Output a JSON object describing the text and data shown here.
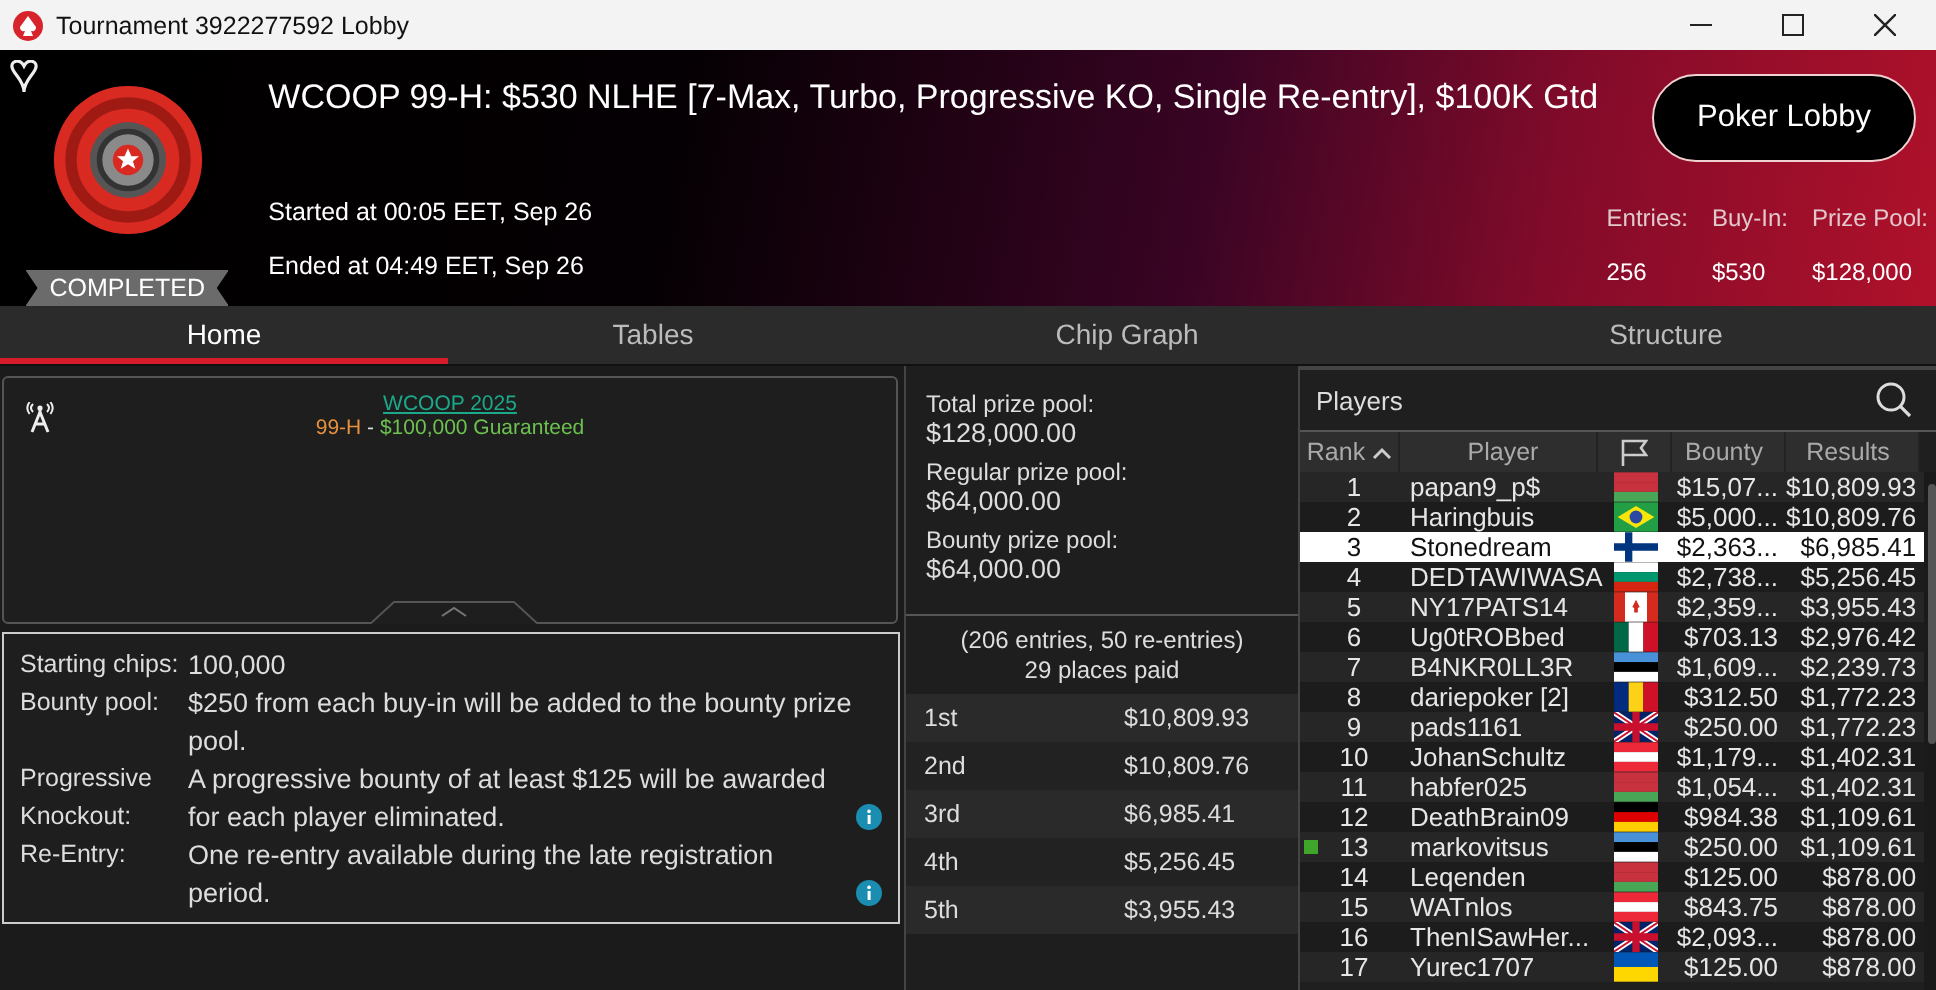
{
  "window": {
    "title": "Tournament 3922277592 Lobby"
  },
  "header": {
    "favorite": false,
    "title": "WCOOP 99-H: $530 NLHE [7-Max, Turbo, Progressive KO, Single Re-entry], $100K Gtd",
    "status": "COMPLETED",
    "started": "Started at 00:05 EET, Sep 26",
    "ended": "Ended at 04:49 EET, Sep 26",
    "button": "Poker Lobby",
    "stats": [
      {
        "label": "Entries:",
        "value": "256"
      },
      {
        "label": "Buy-In:",
        "value": "$530"
      },
      {
        "label": "Prize Pool:",
        "value": "$128,000"
      }
    ]
  },
  "tabs": [
    {
      "label": "Home",
      "selected": true
    },
    {
      "label": "Tables",
      "selected": false
    },
    {
      "label": "Chip Graph",
      "selected": false
    },
    {
      "label": "Structure",
      "selected": false
    }
  ],
  "banner": {
    "link": "WCOOP 2025",
    "event": "99-H",
    "separator": " - ",
    "guarantee": "$100,000 Guaranteed"
  },
  "details": [
    {
      "label": "Starting chips:",
      "value": "100,000",
      "info": false
    },
    {
      "label": "Bounty pool:",
      "value": "$250 from each buy-in will be added to the bounty prize pool.",
      "info": false
    },
    {
      "label": "Progressive Knockout:",
      "value": "A progressive bounty of at least $125 will be awarded for each player eliminated.",
      "info": true
    },
    {
      "label": "Re-Entry:",
      "value": "One re-entry available during the late registration period.",
      "info": true
    }
  ],
  "pools": [
    {
      "label": "Total prize pool:",
      "value": "$128,000.00"
    },
    {
      "label": "Regular prize pool:",
      "value": "$64,000.00"
    },
    {
      "label": "Bounty prize pool:",
      "value": "$64,000.00"
    }
  ],
  "entries_note": "(206 entries, 50 re-entries)",
  "places_paid": "29 places paid",
  "payouts": [
    {
      "place": "1st",
      "amount": "$10,809.93"
    },
    {
      "place": "2nd",
      "amount": "$10,809.76"
    },
    {
      "place": "3rd",
      "amount": "$6,985.41"
    },
    {
      "place": "4th",
      "amount": "$5,256.45"
    },
    {
      "place": "5th",
      "amount": "$3,955.43"
    }
  ],
  "players": {
    "title": "Players",
    "columns": [
      "Rank",
      "Player",
      "Bounty",
      "Results"
    ],
    "rows": [
      {
        "rank": "1",
        "player": "papan9_p$",
        "bounty": "$15,07...",
        "result": "$10,809.93",
        "selected": false,
        "marked": false,
        "flag": {
          "kind": "stripes",
          "parts": [
            {
              "color": "#c8313e"
            },
            {
              "color": "#c8313e"
            },
            {
              "color": "#4aa657"
            }
          ]
        }
      },
      {
        "rank": "2",
        "player": "Haringbuis",
        "bounty": "$5,000...",
        "result": "$10,809.76",
        "selected": false,
        "marked": false,
        "flag": {
          "kind": "diamond",
          "parts": [
            {
              "color": "#229e45"
            },
            {
              "color": "#f8e509"
            },
            {
              "color": "#2b49a3"
            }
          ]
        }
      },
      {
        "rank": "3",
        "player": "Stonedream",
        "bounty": "$2,363...",
        "result": "$6,985.41",
        "selected": true,
        "marked": false,
        "flag": {
          "kind": "cross",
          "parts": [
            {
              "color": "#ffffff"
            },
            {
              "color": "#003580"
            }
          ]
        }
      },
      {
        "rank": "4",
        "player": "DEDTAWIWASA",
        "bounty": "$2,738...",
        "result": "$5,256.45",
        "selected": false,
        "marked": false,
        "flag": {
          "kind": "stripes",
          "parts": [
            {
              "color": "#ffffff"
            },
            {
              "color": "#00966e"
            },
            {
              "color": "#d62612"
            }
          ]
        }
      },
      {
        "rank": "5",
        "player": "NY17PATS14",
        "bounty": "$2,359...",
        "result": "$3,955.43",
        "selected": false,
        "marked": false,
        "flag": {
          "kind": "maple",
          "parts": [
            {
              "color": "#d52b1e"
            },
            {
              "color": "#ffffff"
            }
          ]
        }
      },
      {
        "rank": "6",
        "player": "Ug0tROBbed",
        "bounty": "$703.13",
        "result": "$2,976.42",
        "selected": false,
        "marked": false,
        "flag": {
          "kind": "vstripes",
          "parts": [
            {
              "color": "#006847"
            },
            {
              "color": "#ffffff"
            },
            {
              "color": "#ce1126"
            }
          ]
        }
      },
      {
        "rank": "7",
        "player": "B4NKR0LL3R",
        "bounty": "$1,609...",
        "result": "$2,239.73",
        "selected": false,
        "marked": false,
        "flag": {
          "kind": "stripes",
          "parts": [
            {
              "color": "#4891d9"
            },
            {
              "color": "#000000"
            },
            {
              "color": "#ffffff"
            }
          ]
        }
      },
      {
        "rank": "8",
        "player": "dariepoker [2]",
        "bounty": "$312.50",
        "result": "$1,772.23",
        "selected": false,
        "marked": false,
        "flag": {
          "kind": "vstripes",
          "parts": [
            {
              "color": "#002b7f"
            },
            {
              "color": "#fcd116"
            },
            {
              "color": "#ce1126"
            }
          ]
        }
      },
      {
        "rank": "9",
        "player": "pads1161",
        "bounty": "$250.00",
        "result": "$1,772.23",
        "selected": false,
        "marked": false,
        "flag": {
          "kind": "union",
          "parts": [
            {
              "color": "#012169"
            },
            {
              "color": "#ffffff"
            },
            {
              "color": "#c8102e"
            }
          ]
        }
      },
      {
        "rank": "10",
        "player": "JohanSchultz",
        "bounty": "$1,179...",
        "result": "$1,402.31",
        "selected": false,
        "marked": false,
        "flag": {
          "kind": "stripes",
          "parts": [
            {
              "color": "#ed2939"
            },
            {
              "color": "#ffffff"
            },
            {
              "color": "#ed2939"
            }
          ]
        }
      },
      {
        "rank": "11",
        "player": "habfer025",
        "bounty": "$1,054...",
        "result": "$1,402.31",
        "selected": false,
        "marked": false,
        "flag": {
          "kind": "stripes",
          "parts": [
            {
              "color": "#c8313e"
            },
            {
              "color": "#c8313e"
            },
            {
              "color": "#4aa657"
            }
          ]
        }
      },
      {
        "rank": "12",
        "player": "DeathBrain09",
        "bounty": "$984.38",
        "result": "$1,109.61",
        "selected": false,
        "marked": false,
        "flag": {
          "kind": "stripes",
          "parts": [
            {
              "color": "#000000"
            },
            {
              "color": "#dd0000"
            },
            {
              "color": "#ffce00"
            }
          ]
        }
      },
      {
        "rank": "13",
        "player": "markovitsus",
        "bounty": "$250.00",
        "result": "$1,109.61",
        "selected": false,
        "marked": true,
        "flag": {
          "kind": "stripes",
          "parts": [
            {
              "color": "#4891d9"
            },
            {
              "color": "#000000"
            },
            {
              "color": "#ffffff"
            }
          ]
        }
      },
      {
        "rank": "14",
        "player": "Leqenden",
        "bounty": "$125.00",
        "result": "$878.00",
        "selected": false,
        "marked": false,
        "flag": {
          "kind": "stripes",
          "parts": [
            {
              "color": "#c8313e"
            },
            {
              "color": "#c8313e"
            },
            {
              "color": "#4aa657"
            }
          ]
        }
      },
      {
        "rank": "15",
        "player": "WATnlos",
        "bounty": "$843.75",
        "result": "$878.00",
        "selected": false,
        "marked": false,
        "flag": {
          "kind": "stripes",
          "parts": [
            {
              "color": "#ed2939"
            },
            {
              "color": "#ffffff"
            },
            {
              "color": "#ed2939"
            }
          ]
        }
      },
      {
        "rank": "16",
        "player": "ThenISawHer...",
        "bounty": "$2,093...",
        "result": "$878.00",
        "selected": false,
        "marked": false,
        "flag": {
          "kind": "union",
          "parts": [
            {
              "color": "#012169"
            },
            {
              "color": "#ffffff"
            },
            {
              "color": "#c8102e"
            }
          ]
        }
      },
      {
        "rank": "17",
        "player": "Yurec1707",
        "bounty": "$125.00",
        "result": "$878.00",
        "selected": false,
        "marked": false,
        "flag": {
          "kind": "stripes",
          "parts": [
            {
              "color": "#0057b7"
            },
            {
              "color": "#ffd700"
            }
          ]
        }
      }
    ]
  }
}
